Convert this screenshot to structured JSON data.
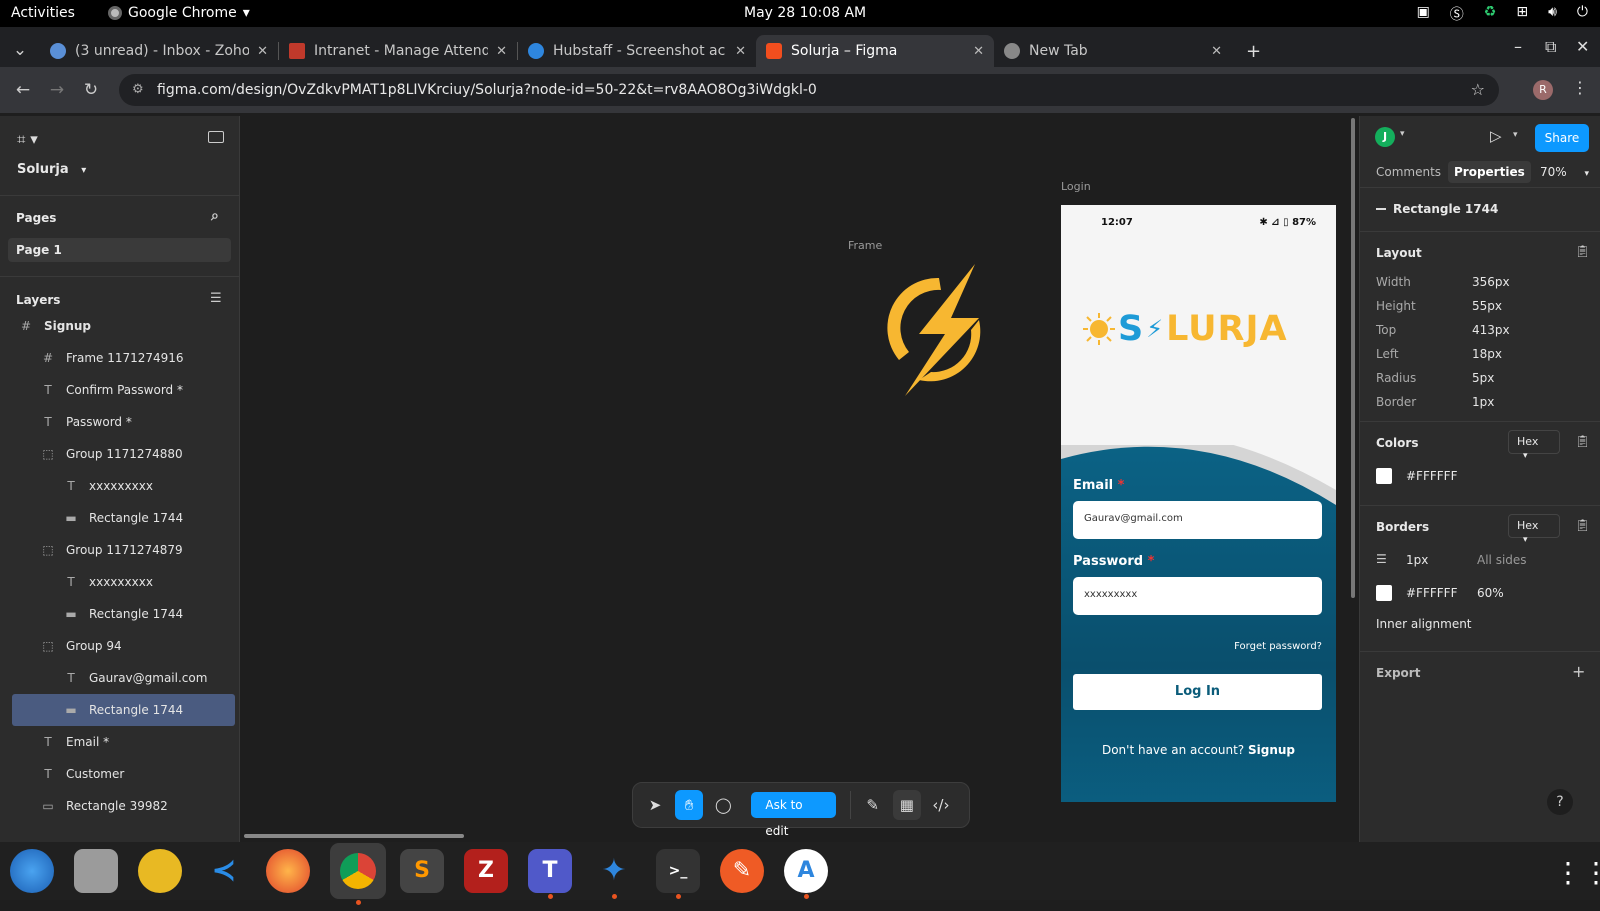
{
  "system": {
    "activities": "Activities",
    "app_name": "Google Chrome",
    "clock": "May 28  10:08 AM"
  },
  "tabs": [
    {
      "title": "(3 unread) - Inbox - Zoho",
      "color": "#5a8fd6",
      "active": false
    },
    {
      "title": "Intranet - Manage Attend",
      "color": "#c0392b",
      "active": false
    },
    {
      "title": "Hubstaff - Screenshot ac",
      "color": "#2e86de",
      "active": false
    },
    {
      "title": "Solurja – Figma",
      "color": "#f24e1e",
      "active": true
    },
    {
      "title": "New Tab",
      "color": "#888888",
      "active": false
    }
  ],
  "address": {
    "url": "figma.com/design/OvZdkvPMAT1p8LIVKrciuy/Solurja?node-id=50-22&t=rv8AAO8Og3iWdgkl-0",
    "profile_initial": "R"
  },
  "left": {
    "project": "Solurja",
    "pages_label": "Pages",
    "page": "Page 1",
    "layers_label": "Layers",
    "layers": [
      {
        "name": "Signup",
        "icon": "#",
        "indent": 0,
        "bold": true
      },
      {
        "name": "Frame 1171274916",
        "icon": "#",
        "indent": 1
      },
      {
        "name": "Confirm Password *",
        "icon": "T",
        "indent": 1
      },
      {
        "name": "Password *",
        "icon": "T",
        "indent": 1
      },
      {
        "name": "Group 1171274880",
        "icon": "⬚",
        "indent": 1
      },
      {
        "name": "xxxxxxxxx",
        "icon": "T",
        "indent": 2
      },
      {
        "name": "Rectangle 1744",
        "icon": "▬",
        "indent": 2
      },
      {
        "name": "Group 1171274879",
        "icon": "⬚",
        "indent": 1
      },
      {
        "name": "xxxxxxxxx",
        "icon": "T",
        "indent": 2
      },
      {
        "name": "Rectangle 1744",
        "icon": "▬",
        "indent": 2
      },
      {
        "name": "Group 94",
        "icon": "⬚",
        "indent": 1
      },
      {
        "name": "Gaurav@gmail.com",
        "icon": "T",
        "indent": 2
      },
      {
        "name": "Rectangle 1744",
        "icon": "▬",
        "indent": 2,
        "selected": true
      },
      {
        "name": "Email *",
        "icon": "T",
        "indent": 1
      },
      {
        "name": "Customer",
        "icon": "T",
        "indent": 1
      },
      {
        "name": "Rectangle 39982",
        "icon": "▭",
        "indent": 1
      }
    ]
  },
  "canvas": {
    "frame_label": "Frame",
    "login_label": "Login",
    "phone": {
      "time": "12:07",
      "status_right": "✱ ⊿ ▯ 87%",
      "brand_s": "S",
      "brand_rest": "LURJA",
      "email_label": "Email",
      "email_value": "Gaurav@gmail.com",
      "password_label": "Password",
      "password_value": "xxxxxxxxx",
      "required_mark": "*",
      "forgot": "Forget password?",
      "login_button": "Log In",
      "signup_text": "Don't have an account?",
      "signup_link": "Signup"
    },
    "toolbar": {
      "ask_to_edit": "Ask to edit"
    }
  },
  "right": {
    "avatar": "J",
    "share": "Share",
    "tab_comments": "Comments",
    "tab_properties": "Properties",
    "zoom": "70%",
    "selection": "Rectangle 1744",
    "layout_title": "Layout",
    "layout": [
      {
        "k": "Width",
        "v": "356px"
      },
      {
        "k": "Height",
        "v": "55px"
      },
      {
        "k": "Top",
        "v": "413px"
      },
      {
        "k": "Left",
        "v": "18px"
      },
      {
        "k": "Radius",
        "v": "5px"
      },
      {
        "k": "Border",
        "v": "1px"
      }
    ],
    "colors_title": "Colors",
    "hex_label": "Hex",
    "fill_color": "#FFFFFF",
    "borders_title": "Borders",
    "border_width": "1px",
    "border_sides": "All sides",
    "border_color": "#FFFFFF",
    "border_opacity": "60%",
    "inner_alignment": "Inner alignment",
    "export_title": "Export"
  },
  "colors": {
    "accent": "#0d99ff",
    "teal": "#0b5c7a",
    "brand_yellow": "#f7b731",
    "brand_blue": "#1e9bd7"
  }
}
